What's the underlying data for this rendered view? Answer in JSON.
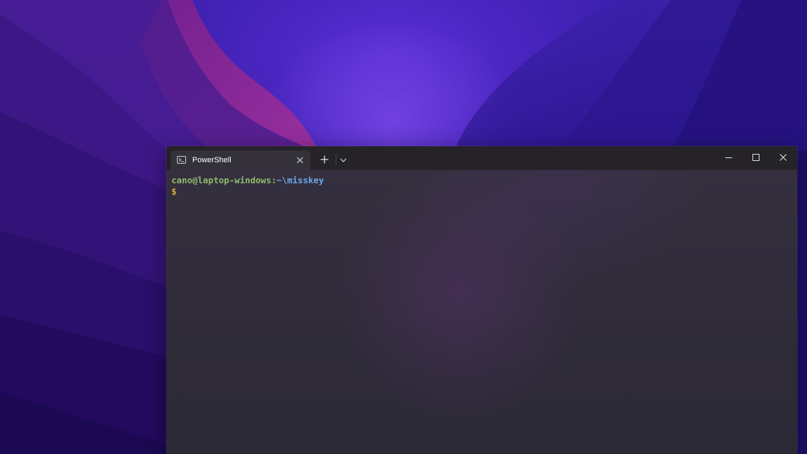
{
  "desktop": {
    "wallpaper": "purple-waves",
    "colors": {
      "base": "#2f1896",
      "magenta": "#8e1f8f",
      "deep": "#1f0b63"
    }
  },
  "window": {
    "app": "Windows Terminal",
    "tabs": [
      {
        "icon": "powershell-icon",
        "title": "PowerShell"
      }
    ],
    "controls": {
      "new_tab_icon": "plus-icon",
      "dropdown_icon": "chevron-down-icon",
      "minimize_icon": "minimize-icon",
      "maximize_icon": "maximize-icon",
      "close_icon": "close-icon"
    },
    "colors": {
      "titlebar": "#252328",
      "tab": "#35313b",
      "background": "#2f2b39"
    }
  },
  "terminal": {
    "user_host": "cano@laptop-windows:",
    "path": "~\\misskey",
    "prompt_symbol": "$",
    "colors": {
      "user": "#8dbb6b",
      "path": "#6aa8e8",
      "prompt": "#c9b13c"
    }
  }
}
